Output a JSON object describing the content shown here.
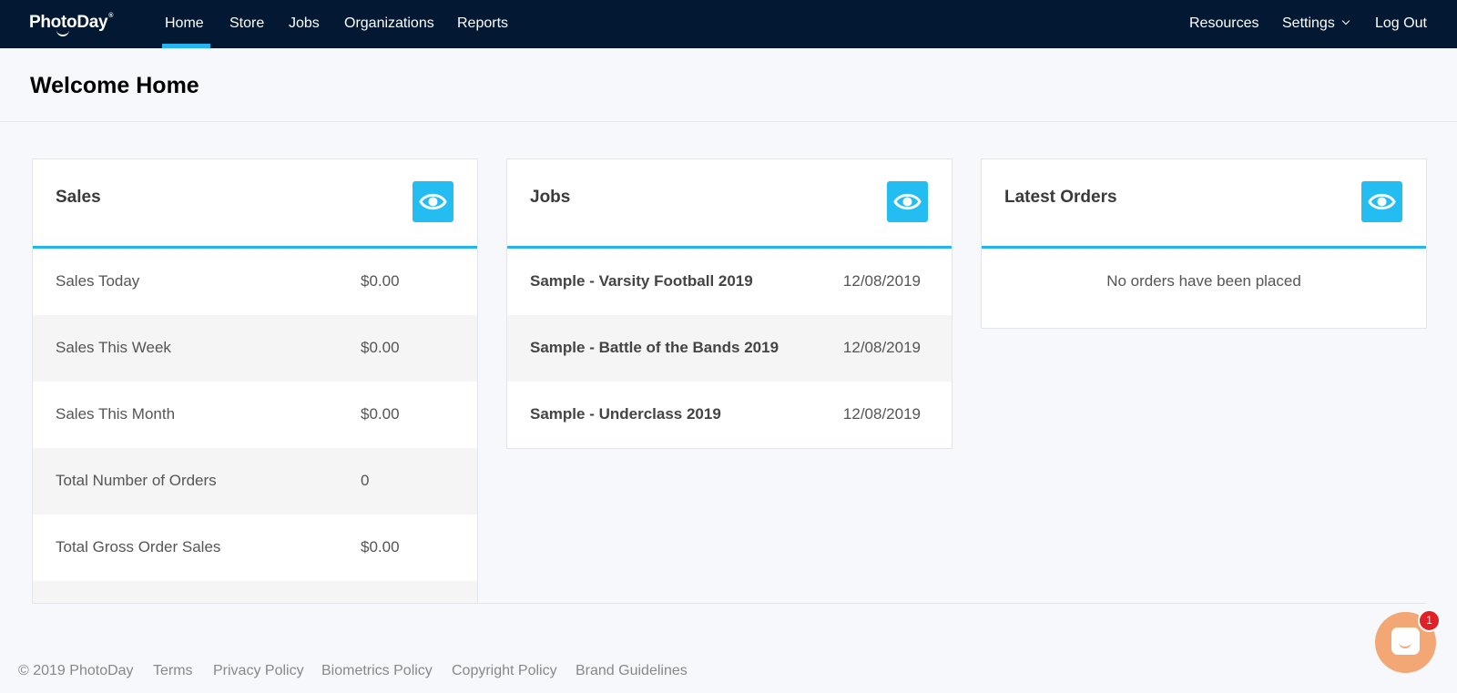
{
  "nav": {
    "logo": "PhotoDay",
    "logo_mark": "®",
    "links": [
      "Home",
      "Store",
      "Jobs",
      "Organizations",
      "Reports"
    ],
    "right": {
      "resources": "Resources",
      "settings": "Settings",
      "logout": "Log Out"
    },
    "active_color": "#23b4f1",
    "bg_color": "#021833"
  },
  "page": {
    "title": "Welcome Home"
  },
  "sales": {
    "title": "Sales",
    "rows": [
      {
        "label": "Sales Today",
        "value": "$0.00"
      },
      {
        "label": "Sales This Week",
        "value": "$0.00"
      },
      {
        "label": "Sales This Month",
        "value": "$0.00"
      },
      {
        "label": "Total Number of Orders",
        "value": "0"
      },
      {
        "label": "Total Gross Order Sales",
        "value": "$0.00"
      }
    ]
  },
  "jobs": {
    "title": "Jobs",
    "rows": [
      {
        "name": "Sample - Varsity Football 2019",
        "date": "12/08/2019"
      },
      {
        "name": "Sample - Battle of the Bands 2019",
        "date": "12/08/2019"
      },
      {
        "name": "Sample - Underclass 2019",
        "date": "12/08/2019"
      }
    ]
  },
  "orders": {
    "title": "Latest Orders",
    "empty": "No orders have been placed"
  },
  "footer": {
    "copyright": "© 2019 PhotoDay",
    "links": [
      "Terms",
      "Privacy Policy",
      "Biometrics Policy",
      "Copyright Policy",
      "Brand Guidelines"
    ]
  },
  "chat": {
    "badge": "1",
    "icon": "chat-bubble-icon",
    "color": "#f2a774"
  },
  "icons": {
    "view": "eye-icon",
    "dropdown": "chevron-down-icon"
  }
}
